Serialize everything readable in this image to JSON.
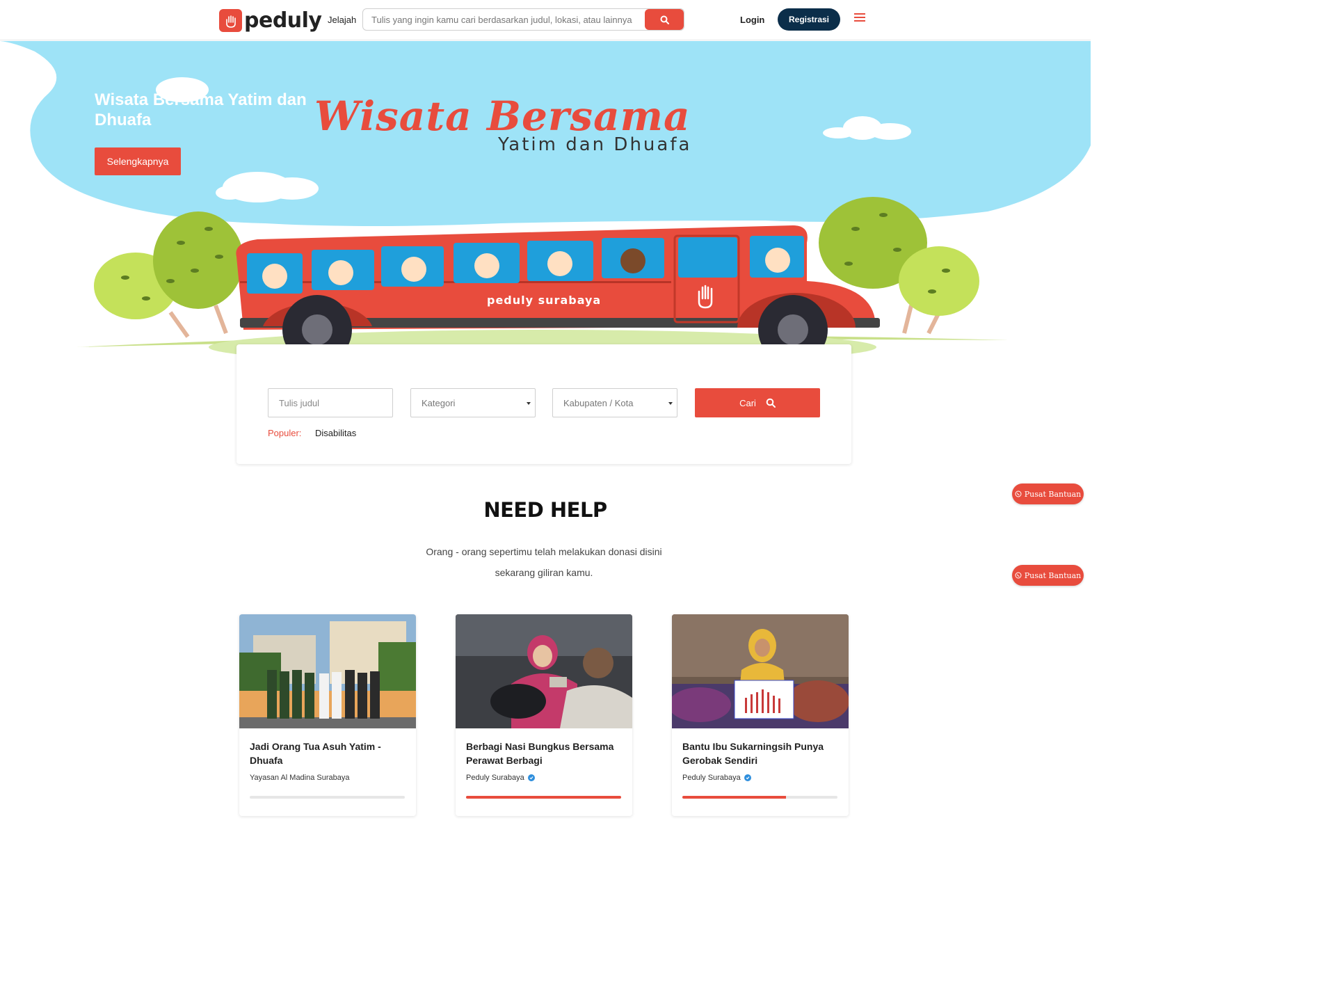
{
  "header": {
    "logo_text": "peduly",
    "nav_jelajah": "Jelajah",
    "search_placeholder": "Tulis yang ingin kamu cari berdasarkan judul, lokasi, atau lainnya",
    "login_label": "Login",
    "register_label": "Registrasi"
  },
  "hero": {
    "title": "Wisata Bersama Yatim dan Dhuafa",
    "button_label": "Selengkapnya",
    "script_title": "Wisata Bersama",
    "script_subtitle": "Yatim dan Dhuafa",
    "bus_label": "peduly surabaya"
  },
  "search_card": {
    "title_placeholder": "Tulis judul",
    "category_label": "Kategori",
    "city_label": "Kabupaten / Kota",
    "search_button": "Cari",
    "popular_label": "Populer:",
    "popular_tag": "Disabilitas"
  },
  "help": {
    "title": "NEED HELP",
    "desc_line1": "Orang - orang sepertimu telah melakukan donasi disini",
    "desc_line2": "sekarang giliran kamu."
  },
  "help_button_label": "Pusat Bantuan",
  "campaigns": [
    {
      "title": "Jadi Orang Tua Asuh Yatim - Dhuafa",
      "org": "Yayasan Al Madina Surabaya",
      "verified": false,
      "progress": 0.0
    },
    {
      "title": "Berbagi Nasi Bungkus Bersama Perawat Berbagi",
      "org": "Peduly Surabaya",
      "verified": true,
      "progress": 1.0
    },
    {
      "title": "Bantu Ibu Sukarningsih Punya Gerobak Sendiri",
      "org": "Peduly Surabaya",
      "verified": true,
      "progress": 0.67
    }
  ],
  "colors": {
    "brand": "#e84c3d",
    "navy": "#0b2e4a",
    "sky": "#9ee3f7"
  }
}
